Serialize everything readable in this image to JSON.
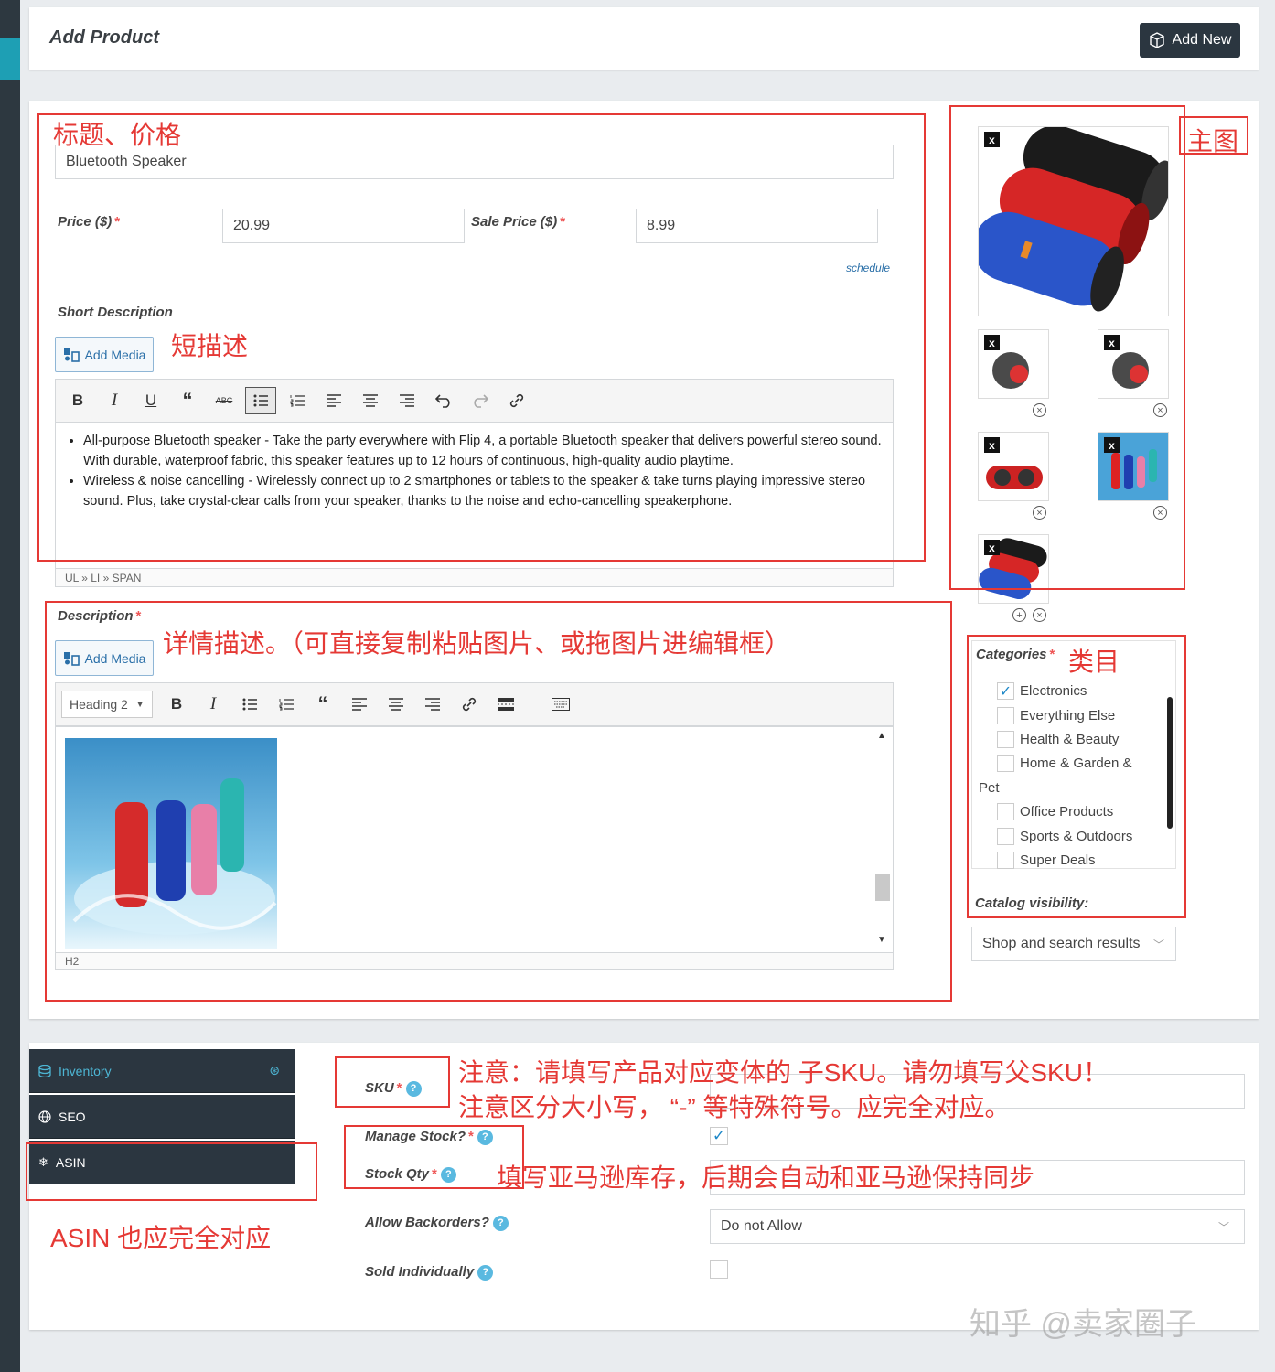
{
  "header": {
    "title": "Add Product",
    "add_new_label": "Add New"
  },
  "product": {
    "title_value": "Bluetooth Speaker",
    "price_label": "Price ($)",
    "price_value": "20.99",
    "sale_price_label": "Sale Price ($)",
    "sale_price_value": "8.99",
    "schedule_link": "schedule"
  },
  "short_description": {
    "label": "Short Description",
    "add_media_label": "Add Media",
    "bullets": [
      "All-purpose Bluetooth speaker - Take the party everywhere with Flip 4, a portable Bluetooth speaker that delivers powerful stereo sound. With durable, waterproof fabric, this speaker features up to 12 hours of continuous, high-quality audio playtime.",
      "Wireless & noise cancelling - Wirelessly connect up to 2 smartphones or tablets to the speaker & take turns playing impressive stereo sound. Plus, take crystal-clear calls from your speaker, thanks to the noise and echo-cancelling speakerphone."
    ],
    "statusbar": "UL » LI » SPAN"
  },
  "description": {
    "label": "Description",
    "add_media_label": "Add Media",
    "format_select": "Heading 2",
    "statusbar": "H2"
  },
  "categories": {
    "label": "Categories",
    "items": [
      {
        "name": "Electronics",
        "checked": true
      },
      {
        "name": "Everything Else",
        "checked": false
      },
      {
        "name": "Health & Beauty",
        "checked": false
      },
      {
        "name": "Home & Garden &",
        "checked": false
      },
      {
        "name": "Pet",
        "checked": false
      },
      {
        "name": "Office Products",
        "checked": false
      },
      {
        "name": "Sports & Outdoors",
        "checked": false
      },
      {
        "name": "Super Deals",
        "checked": false
      }
    ],
    "visibility_label": "Catalog visibility:",
    "visibility_value": "Shop and search results"
  },
  "tabs": {
    "inventory": "Inventory",
    "seo": "SEO",
    "asin": "ASIN"
  },
  "inventory": {
    "sku_label": "SKU",
    "manage_stock_label": "Manage Stock?",
    "manage_stock_checked": true,
    "stock_qty_label": "Stock Qty",
    "allow_backorders_label": "Allow Backorders?",
    "allow_backorders_value": "Do not Allow",
    "sold_individually_label": "Sold Individually"
  },
  "annotations": {
    "title_price": "标题、价格",
    "main_image": "主图",
    "short_desc": "短描述",
    "detail_desc": "详情描述。（可直接复制粘贴图片、或拖图片进编辑框）",
    "categories": "类目",
    "sku_note_1": "注意：请填写产品对应变体的 子SKU。请勿填写父SKU！",
    "sku_note_2": "注意区分大小写，  “-”  等特殊符号。应完全对应。",
    "stock_note": "填写亚马逊库存，后期会自动和亚马逊保持同步",
    "asin_note": "ASIN 也应完全对应"
  },
  "watermark": "知乎 @卖家圈子",
  "colors": {
    "annotation_red": "#e53935",
    "dark_nav": "#2b3640",
    "accent": "#1e9fb4"
  }
}
